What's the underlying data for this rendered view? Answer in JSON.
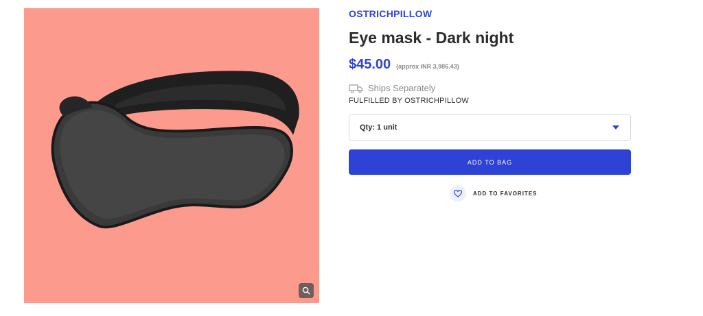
{
  "product": {
    "brand": "OSTRICHPILLOW",
    "title": "Eye mask - Dark night",
    "price": "$45.00",
    "approx_price": "(approx INR 3,986.43)",
    "shipping": "Ships Separately",
    "fulfilled_by": "FULFILLED BY OSTRICHPILLOW"
  },
  "quantity": {
    "selected": "Qty: 1 unit"
  },
  "actions": {
    "add_to_bag": "ADD TO BAG",
    "add_to_favorites": "ADD TO FAVORITES"
  },
  "icons": {
    "zoom": "search-icon",
    "shipping": "truck-icon",
    "caret": "caret-down-icon",
    "favorite": "heart-icon"
  },
  "colors": {
    "accent": "#2e43d6",
    "image_background": "#fd9a8e"
  }
}
